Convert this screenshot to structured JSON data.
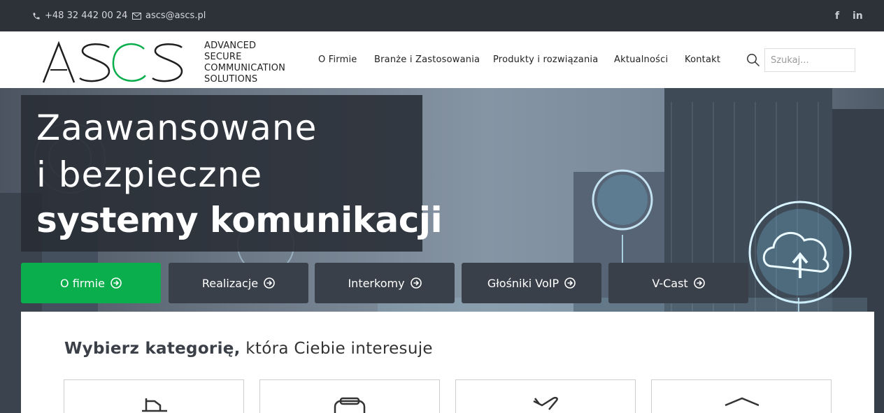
{
  "topbar": {
    "phone": "+48 32 442 00 24",
    "email": "ascs@ascs.pl",
    "social": [
      {
        "icon": "facebook-icon",
        "label": "f"
      },
      {
        "icon": "linkedin-icon",
        "label": "in"
      }
    ]
  },
  "header": {
    "logo_text": "ASCS",
    "logo_subtitle": [
      "ADVANCED",
      "SECURE",
      "COMMUNICATION",
      "SOLUTIONS"
    ],
    "nav": [
      {
        "label": "O Firmie"
      },
      {
        "label": "Branże i Zastosowania"
      },
      {
        "label": "Produkty i rozwiązania"
      },
      {
        "label": "Aktualności"
      },
      {
        "label": "Kontakt"
      }
    ],
    "search": {
      "placeholder": "Szukaj..."
    }
  },
  "hero": {
    "line1": "Zaawansowane",
    "line2": "i bezpieczne",
    "line3": "systemy komunikacji",
    "buttons": [
      {
        "label": "O firmie"
      },
      {
        "label": "Realizacje"
      },
      {
        "label": "Interkomy"
      },
      {
        "label": "Głośniki VoIP"
      },
      {
        "label": "V-Cast"
      }
    ],
    "decor_symbol": "$"
  },
  "panel": {
    "title_bold": "Wybierz kategorię,",
    "title_rest": " która Ciebie interesuje",
    "cards": [
      {
        "icon": "ship-icon"
      },
      {
        "icon": "train-icon"
      },
      {
        "icon": "airplane-icon"
      },
      {
        "icon": "building-icon"
      }
    ]
  },
  "colors": {
    "topbar_bg": "#2d3138",
    "accent_green": "#0aae4c",
    "button_dark": "#3a4049"
  }
}
